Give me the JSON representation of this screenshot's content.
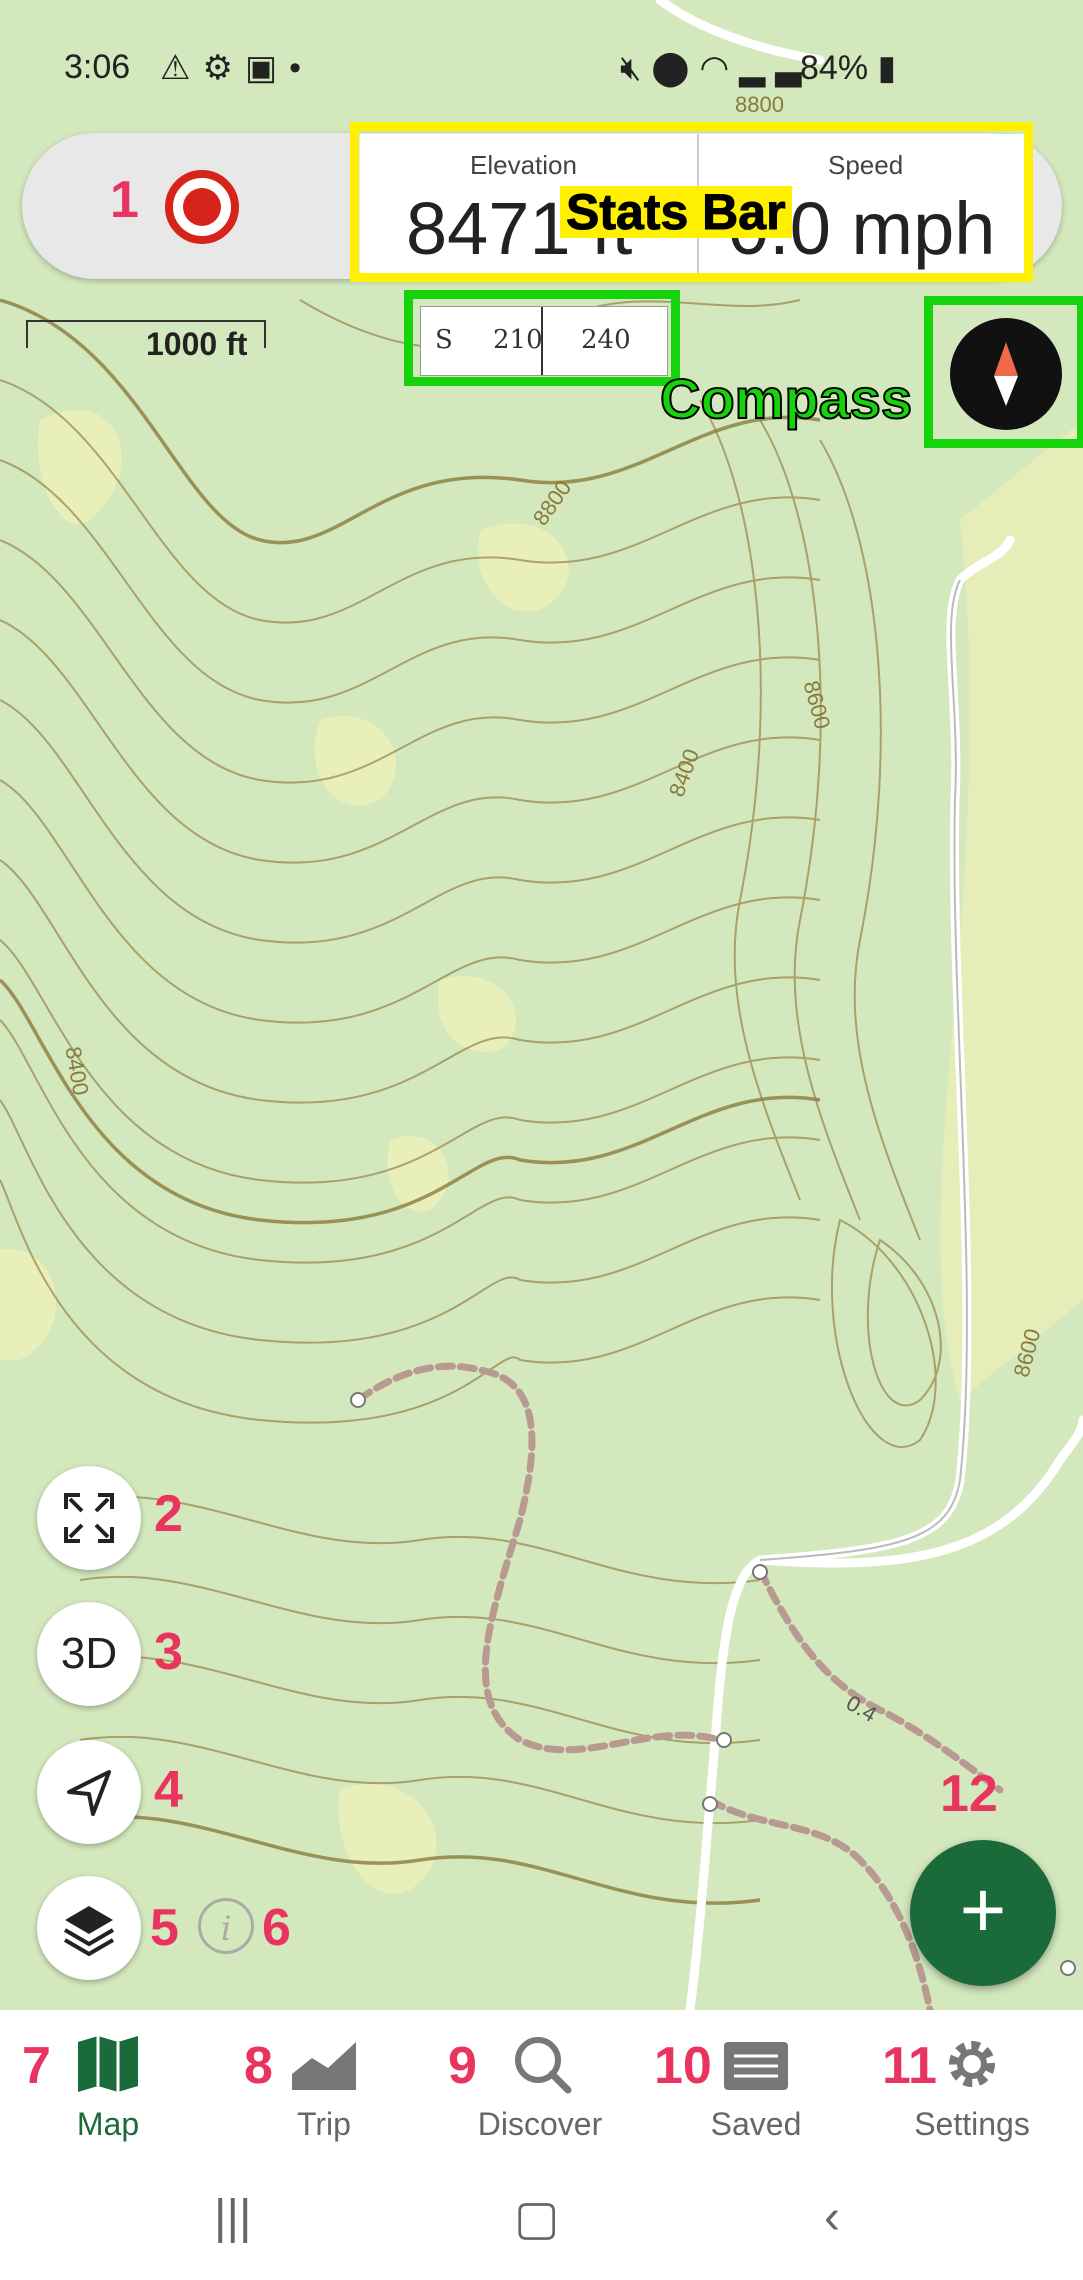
{
  "status_bar": {
    "time": "3:06",
    "battery": "84%",
    "left_icons": [
      "warning-icon",
      "gear-icon",
      "image-icon",
      "dot"
    ],
    "right_icons": [
      "mute-icon",
      "location-icon",
      "wifi-icon",
      "signal-icon",
      "battery-icon"
    ]
  },
  "stats_bar": {
    "elevation_label": "Elevation",
    "elevation_value": "8471 ft",
    "speed_label": "Speed",
    "speed_value": "0.0 mph"
  },
  "callouts": {
    "stats_bar": "Stats Bar",
    "compass": "Compass"
  },
  "map": {
    "scale": "1000 ft",
    "heading_ticks": [
      "S",
      "210",
      "240"
    ],
    "contour_labels": [
      "8800",
      "8800",
      "8600",
      "8400",
      "8400",
      "8600",
      "0.4"
    ],
    "colors": {
      "land": "#d3e8bd",
      "clearing": "#eef0b8",
      "contour": "#9b8a4e",
      "road": "#ffffff",
      "trail": "#b89a92"
    }
  },
  "left_buttons": [
    {
      "label": "",
      "icon": "fullscreen-icon",
      "number": "2"
    },
    {
      "label": "3D",
      "icon": "",
      "number": "3"
    },
    {
      "label": "",
      "icon": "navigation-arrow-icon",
      "number": "4"
    },
    {
      "label": "",
      "icon": "layers-icon",
      "number": "5"
    }
  ],
  "annotation_numbers": {
    "record": "1",
    "info": "6",
    "map": "7",
    "trip": "8",
    "discover": "9",
    "saved": "10",
    "settings": "11",
    "add": "12"
  },
  "info_button": {
    "glyph": "i"
  },
  "add_button": {
    "glyph": "+"
  },
  "bottom_nav": [
    {
      "label": "Map",
      "icon": "map-icon",
      "active": true
    },
    {
      "label": "Trip",
      "icon": "chart-icon",
      "active": false
    },
    {
      "label": "Discover",
      "icon": "search-icon",
      "active": false
    },
    {
      "label": "Saved",
      "icon": "folder-icon",
      "active": false
    },
    {
      "label": "Settings",
      "icon": "gear-icon",
      "active": false
    }
  ],
  "accent_colors": {
    "record_red": "#d6241a",
    "brand_green": "#1b6b3a",
    "highlight_yellow": "#ffef00",
    "highlight_green": "#16d40c",
    "annotation_pink": "#e8345f"
  }
}
